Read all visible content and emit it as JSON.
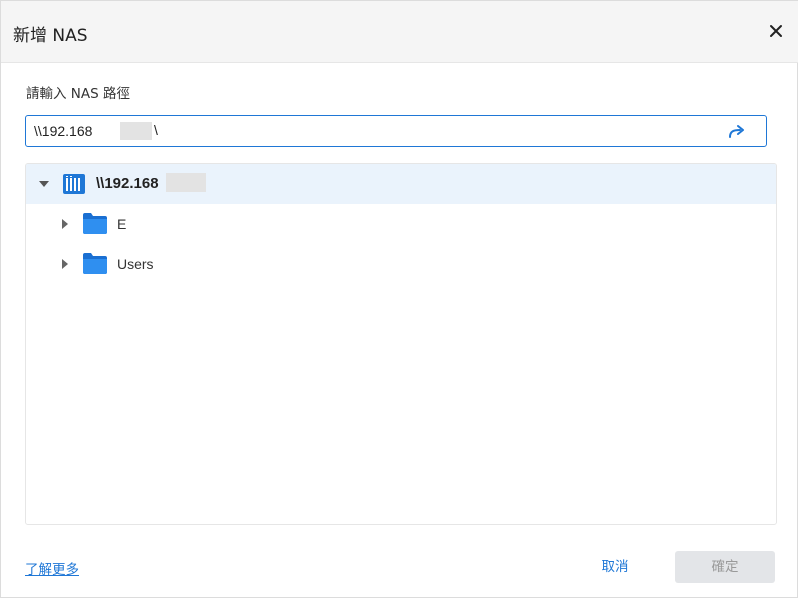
{
  "dialog": {
    "title": "新增 NAS",
    "close_icon": "close-icon"
  },
  "form": {
    "prompt": "請輸入 NAS 路徑",
    "path_value": "\\\\192.168",
    "path_suffix": "\\",
    "go_icon": "go-arrow-icon"
  },
  "tree": {
    "root": {
      "label": "\\\\192.168",
      "icon": "nas-icon",
      "expanded": true
    },
    "children": [
      {
        "label": "E",
        "icon": "folder-icon",
        "expanded": false
      },
      {
        "label": "Users",
        "icon": "folder-icon",
        "expanded": false
      }
    ]
  },
  "footer": {
    "learn_more": "了解更多",
    "cancel_label": "取消",
    "ok_label": "確定"
  },
  "colors": {
    "accent": "#1f77d6",
    "selected_row": "#eaf3fc",
    "disabled_button": "#e3e5e8"
  }
}
